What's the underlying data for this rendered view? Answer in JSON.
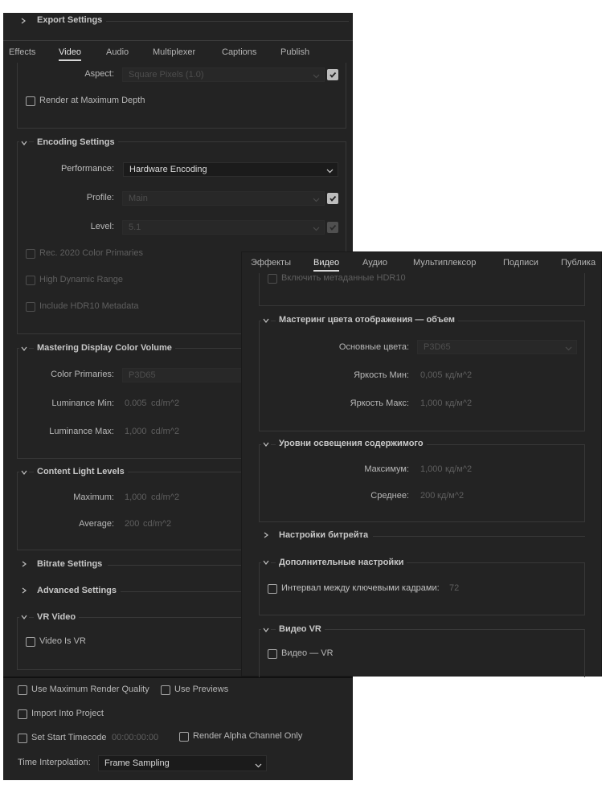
{
  "left": {
    "export_settings": "Export Settings",
    "tabs": [
      "Effects",
      "Video",
      "Audio",
      "Multiplexer",
      "Captions",
      "Publish"
    ],
    "aspect_label": "Aspect:",
    "aspect_value": "Square Pixels (1.0)",
    "render_max_depth": "Render at Maximum Depth",
    "encoding_settings": "Encoding Settings",
    "performance_label": "Performance:",
    "performance_value": "Hardware Encoding",
    "profile_label": "Profile:",
    "profile_value": "Main",
    "level_label": "Level:",
    "level_value": "5.1",
    "rec2020": "Rec. 2020 Color Primaries",
    "hdr": "High Dynamic Range",
    "hdr10": "Include HDR10 Metadata",
    "mastering": "Mastering Display Color Volume",
    "color_primaries_label": "Color Primaries:",
    "color_primaries_value": "P3D65",
    "lum_min_label": "Luminance Min:",
    "lum_min_value": "0.005",
    "lum_min_unit": "cd/m^2",
    "lum_max_label": "Luminance Max:",
    "lum_max_value": "1,000",
    "lum_max_unit": "cd/m^2",
    "content_light": "Content Light Levels",
    "maximum_label": "Maximum:",
    "maximum_value": "1,000",
    "maximum_unit": "cd/m^2",
    "average_label": "Average:",
    "average_value": "200",
    "average_unit": "cd/m^2",
    "bitrate": "Bitrate Settings",
    "advanced": "Advanced Settings",
    "vr_video": "VR Video",
    "video_is_vr": "Video Is VR",
    "use_max_quality": "Use Maximum Render Quality",
    "use_previews": "Use Previews",
    "import_project": "Import Into Project",
    "set_start_tc": "Set Start Timecode",
    "timecode": "00:00:00:00",
    "render_alpha": "Render Alpha Channel Only",
    "time_interp_label": "Time Interpolation:",
    "time_interp_value": "Frame Sampling"
  },
  "right": {
    "tabs": [
      "Эффекты",
      "Видео",
      "Аудио",
      "Мультиплексор",
      "Подписи",
      "Публика"
    ],
    "hdr10": "Включить метаданные HDR10",
    "mastering": "Мастеринг цвета отображения — объем",
    "primaries_label": "Основные цвета:",
    "primaries_value": "P3D65",
    "lum_min_label": "Яркость Мин:",
    "lum_min_value": "0,005",
    "lum_min_unit": "кд/м^2",
    "lum_max_label": "Яркость Макс:",
    "lum_max_value": "1,000",
    "lum_max_unit": "кд/м^2",
    "content_light": "Уровни освещения содержимого",
    "maximum_label": "Максимум:",
    "maximum_value": "1,000",
    "maximum_unit": "кд/м^2",
    "average_label": "Среднее:",
    "average_value": "200",
    "average_unit": "кд/м^2",
    "bitrate": "Настройки битрейта",
    "advanced": "Дополнительные настройки",
    "keyframe": "Интервал между ключевыми кадрами:",
    "keyframe_value": "72",
    "vr_video": "Видео VR",
    "video_vr": "Видео — VR"
  }
}
